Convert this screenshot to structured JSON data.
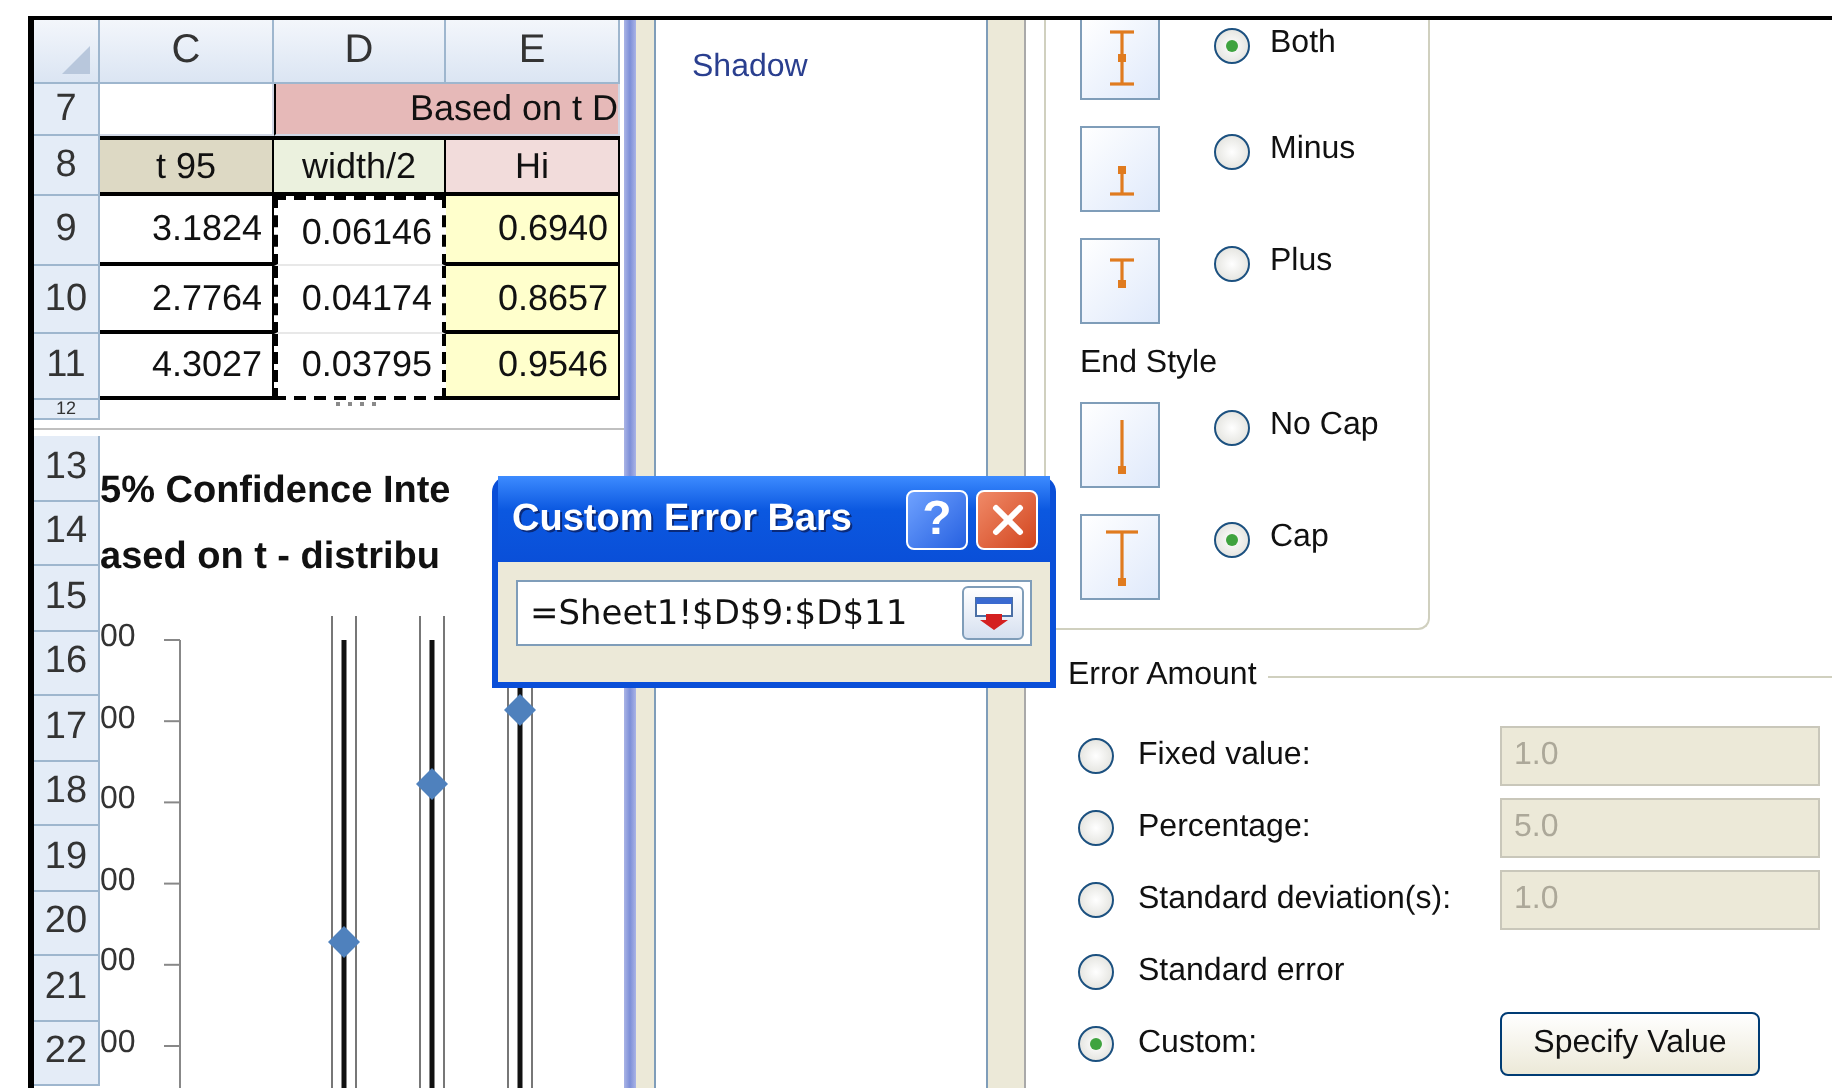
{
  "sheet": {
    "columns": [
      "C",
      "D",
      "E"
    ],
    "rows": [
      {
        "header": "7",
        "kind": "merged",
        "cells": [
          {
            "text": "",
            "color": "#ffffff"
          },
          {
            "text": "Based on t D",
            "color": "#e6b9b8",
            "kind": "merged-header"
          }
        ]
      },
      {
        "header": "8",
        "kind": "heading",
        "cells": [
          {
            "text": "t 95",
            "color": "#ddd9c4",
            "in_copy_range": false
          },
          {
            "text": "width/2",
            "color": "#ebf1de",
            "in_copy_range": false
          },
          {
            "text": "Hi",
            "color": "#f2dcdb",
            "in_copy_range": false
          }
        ]
      },
      {
        "header": "9",
        "kind": "number",
        "cells": [
          {
            "text": "3.1824",
            "color": "#ffffff",
            "in_copy_range": false
          },
          {
            "text": "0.06146",
            "color": "#ffffff",
            "in_copy_range": true
          },
          {
            "text": "0.6940",
            "color": "#ffffcc",
            "in_copy_range": false
          }
        ]
      },
      {
        "header": "10",
        "kind": "number",
        "cells": [
          {
            "text": "2.7764",
            "color": "#ffffff",
            "in_copy_range": false
          },
          {
            "text": "0.04174",
            "color": "#ffffff",
            "in_copy_range": true
          },
          {
            "text": "0.8657",
            "color": "#ffffcc",
            "in_copy_range": false
          }
        ]
      },
      {
        "header": "11",
        "kind": "number",
        "cells": [
          {
            "text": "4.3027",
            "color": "#ffffff",
            "in_copy_range": false
          },
          {
            "text": "0.03795",
            "color": "#ffffff",
            "in_copy_range": true
          },
          {
            "text": "0.9546",
            "color": "#ffffcc",
            "in_copy_range": false
          }
        ]
      },
      {
        "header": "12",
        "kind": "clipped",
        "cells": []
      }
    ],
    "chart_row_headers": [
      "13",
      "14",
      "15",
      "16",
      "17",
      "18",
      "19",
      "20",
      "21",
      "22"
    ],
    "chart": {
      "title_lines": [
        "5% Confidence Inte",
        "ased on t - distribu"
      ],
      "axis_labels": [
        "00",
        "00",
        "00",
        "00",
        "00",
        "00"
      ]
    }
  },
  "format_pane": {
    "nav_items": [
      {
        "label": "Shadow",
        "selected": false
      }
    ],
    "direction_options": [
      {
        "label": "Both",
        "kind": "both",
        "selected": true
      },
      {
        "label": "Minus",
        "kind": "minus",
        "selected": false
      },
      {
        "label": "Plus",
        "kind": "plus",
        "selected": false
      }
    ],
    "end_style": {
      "title": "End Style",
      "options": [
        {
          "label": "No Cap",
          "kind": "no-cap",
          "selected": false
        },
        {
          "label": "Cap",
          "kind": "cap",
          "selected": true
        }
      ]
    },
    "error_amount": {
      "title": "Error Amount",
      "options": [
        {
          "label": "Fixed value:",
          "selected": false,
          "value": "1.0",
          "disabled": true
        },
        {
          "label": "Percentage:",
          "selected": false,
          "value": "5.0",
          "disabled": true
        },
        {
          "label": "Standard deviation(s):",
          "selected": false,
          "value": "1.0",
          "disabled": true
        },
        {
          "label": "Standard error",
          "selected": false
        },
        {
          "label": "Custom:",
          "selected": true,
          "button": "Specify Value"
        }
      ]
    }
  },
  "dialog": {
    "title": "Custom Error Bars",
    "help_button": "?",
    "value": "=Sheet1!$D$9:$D$11"
  }
}
